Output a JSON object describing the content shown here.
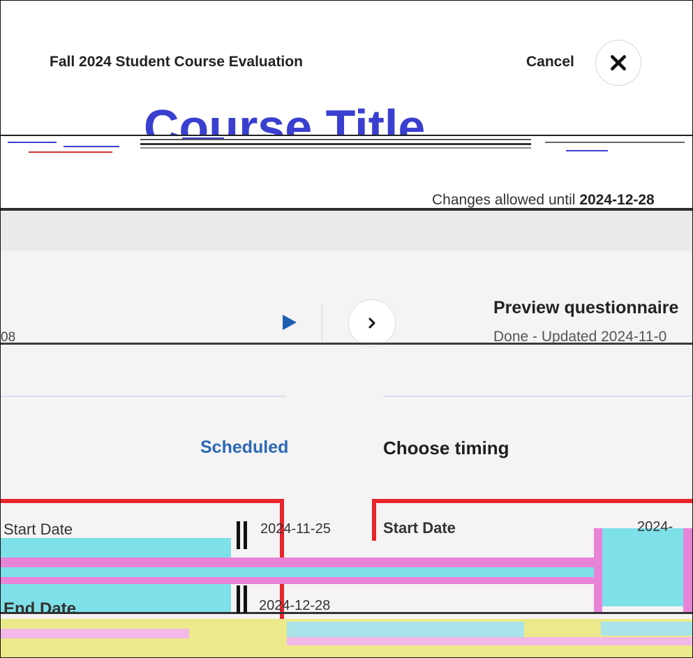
{
  "header": {
    "app_title": "Fall 2024 Student Course Evaluation",
    "cancel_label": "Cancel",
    "close_icon": "close-x-icon"
  },
  "course": {
    "title": "Course Title",
    "changes_prefix": "Changes allowed until ",
    "changes_date": "2024-12-28"
  },
  "steps": {
    "previous_date": "08",
    "preview_title": "Preview questionnaire",
    "preview_status": "Done - Updated 2024-11-0"
  },
  "timing": {
    "scheduled_label": "Scheduled",
    "choose_timing_label": "Choose timing",
    "start_date_label": "Start Date",
    "start_date_value": "2024-11-25",
    "end_date_label": "End Date",
    "end_date_value": "2024-12-28",
    "right_start_label": "Start Date",
    "right_start_value": "2024-"
  },
  "colors": {
    "title_blue": "#3a3fd0",
    "link_blue": "#2b6ab5",
    "highlight_red": "#e8252c",
    "panel_grey": "#f5f3f4"
  }
}
